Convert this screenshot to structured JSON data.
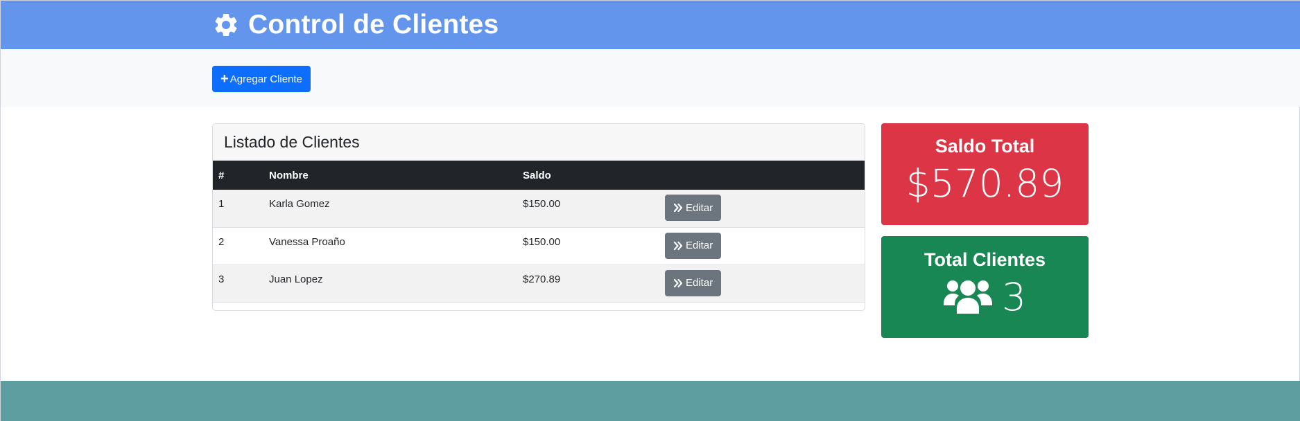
{
  "header": {
    "title": "Control de Clientes",
    "icon": "gear-icon"
  },
  "toolbar": {
    "add_label": "Agregar Cliente"
  },
  "clients_card": {
    "title": "Listado de Clientes",
    "columns": [
      "#",
      "Nombre",
      "Saldo",
      ""
    ],
    "rows": [
      {
        "num": "1",
        "name": "Karla Gomez",
        "saldo": "$150.00",
        "action": "Editar"
      },
      {
        "num": "2",
        "name": "Vanessa Proaño",
        "saldo": "$150.00",
        "action": "Editar"
      },
      {
        "num": "3",
        "name": "Juan Lopez",
        "saldo": "$270.89",
        "action": "Editar"
      }
    ]
  },
  "stats": {
    "saldo_total": {
      "title": "Saldo Total",
      "value": "$570.89"
    },
    "total_clientes": {
      "title": "Total Clientes",
      "value": "3",
      "icon": "users-icon"
    }
  },
  "colors": {
    "header": "#6495ed",
    "primary": "#0d6efd",
    "danger": "#dc3545",
    "success": "#198754",
    "secondary": "#6c757d",
    "footer": "#5f9ea0"
  }
}
